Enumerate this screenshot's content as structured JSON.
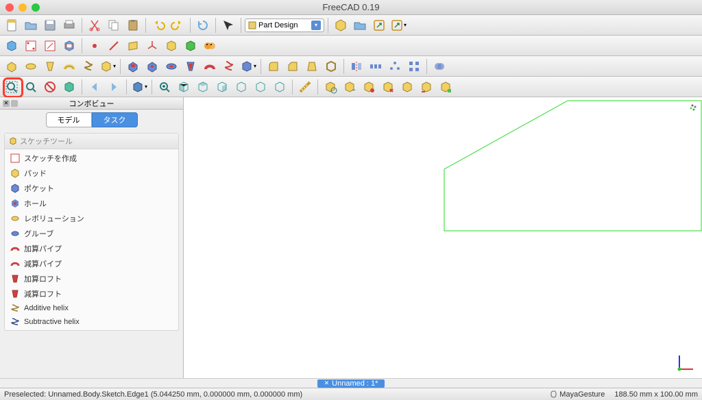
{
  "title": "FreeCAD 0.19",
  "workbench_selector": {
    "value": "Part Design"
  },
  "panel": {
    "title": "コンボビュー",
    "tabs": {
      "model": "モデル",
      "task": "タスク"
    },
    "section_title": "スケッチツール",
    "items": [
      {
        "label": "スケッチを作成",
        "icon": "sketch"
      },
      {
        "label": "パッド",
        "icon": "pad"
      },
      {
        "label": "ポケット",
        "icon": "pocket"
      },
      {
        "label": "ホール",
        "icon": "hole"
      },
      {
        "label": "レボリューション",
        "icon": "revolution"
      },
      {
        "label": "グルーブ",
        "icon": "groove"
      },
      {
        "label": "加算パイプ",
        "icon": "add-pipe"
      },
      {
        "label": "減算パイプ",
        "icon": "sub-pipe"
      },
      {
        "label": "加算ロフト",
        "icon": "add-loft"
      },
      {
        "label": "減算ロフト",
        "icon": "sub-loft"
      },
      {
        "label": "Additive helix",
        "icon": "add-helix"
      },
      {
        "label": "Subtractive helix",
        "icon": "sub-helix"
      }
    ]
  },
  "document_tab": "Unnamed : 1*",
  "status": {
    "left": "Preselected: Unnamed.Body.Sketch.Edge1 (5.044250 mm, 0.000000 mm, 0.000000 mm)",
    "nav_style": "MayaGesture",
    "dimensions": "188.50 mm x 100.00 mm"
  },
  "highlight": {
    "tool": "fit-all"
  },
  "colors": {
    "sketch_line": "#4de04d",
    "accent": "#4a90e2",
    "highlight_ring": "#ff3b30"
  }
}
